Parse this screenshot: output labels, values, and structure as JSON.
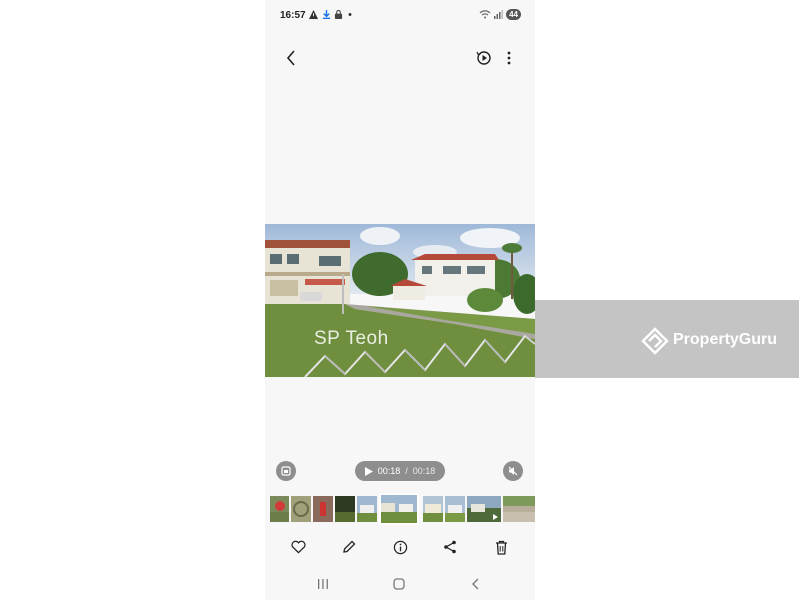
{
  "status_bar": {
    "time": "16:57",
    "left_icons": [
      "warning-icon",
      "download-icon",
      "lock-icon",
      "dot-icon"
    ],
    "right_icons": [
      "wifi-icon",
      "signal-icon"
    ],
    "battery": "44"
  },
  "top_bar": {
    "back_icon": "back-arrow-icon",
    "remaster_icon": "remaster-icon",
    "more_icon": "more-options-icon"
  },
  "photo": {
    "watermark": "SP Teoh"
  },
  "overlay": {
    "brand": "PropertyGuru"
  },
  "player": {
    "current_time": "00:18",
    "separator": "/",
    "duration": "00:18"
  },
  "filmstrip": {
    "thumbnails": [
      "thumb-flower",
      "thumb-plant",
      "thumb-person",
      "thumb-dark",
      "thumb-house",
      "thumb-current",
      "thumb-house-2",
      "thumb-house-3",
      "thumb-video",
      "thumb-road"
    ]
  },
  "bottom_actions": [
    "favorite-icon",
    "edit-icon",
    "info-icon",
    "share-icon",
    "delete-icon"
  ],
  "nav_bar": [
    "recents-icon",
    "home-icon",
    "back-nav-icon"
  ],
  "colors": {
    "background": "#f7f7f7",
    "control_gray": "#8e8e8e",
    "overlay_gray": "#c4c4c4"
  }
}
